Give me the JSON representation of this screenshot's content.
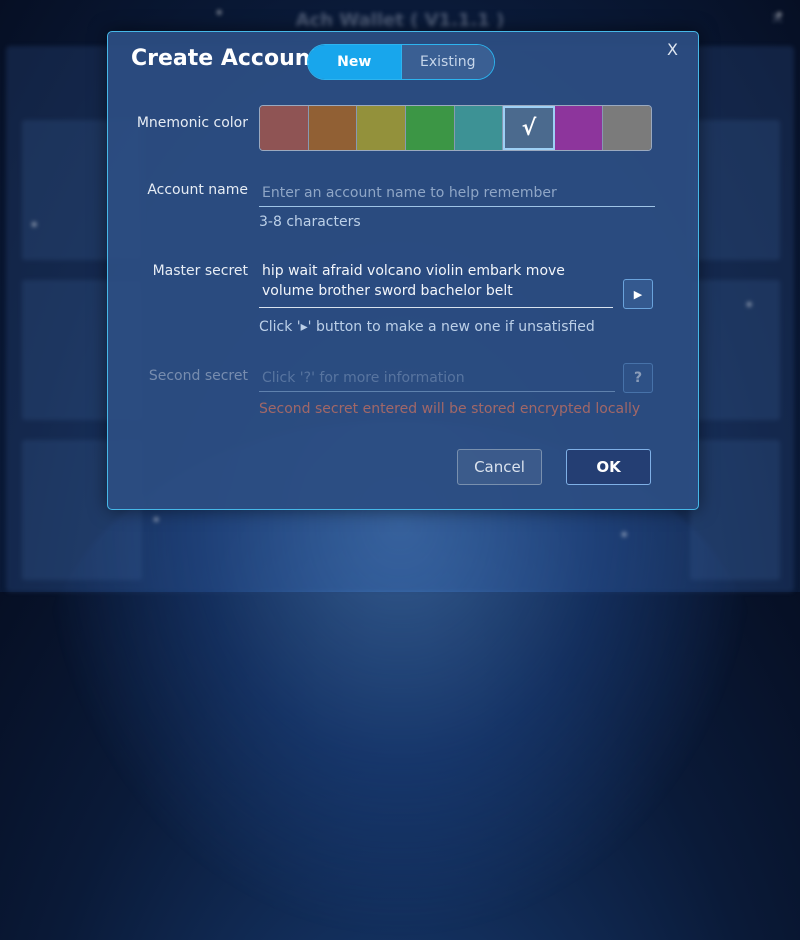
{
  "background": {
    "app_title": "Ach Wallet ( V1.1.1 )",
    "close_label": "×"
  },
  "modal": {
    "title": "Create Account",
    "close_label": "X",
    "tabs": [
      {
        "label": "New",
        "active": true
      },
      {
        "label": "Existing",
        "active": false
      }
    ],
    "mnemonic_color": {
      "label": "Mnemonic color",
      "swatches": [
        "#8f5454",
        "#916034",
        "#93913b",
        "#3c9645",
        "#3d9295",
        "#4b6a8e",
        "#8d359c",
        "#7b7b7b"
      ],
      "selected_index": 5,
      "selected_mark": "√"
    },
    "account_name": {
      "label": "Account name",
      "placeholder": "Enter an account name to help remember",
      "value": "",
      "hint": "3-8 characters"
    },
    "master_secret": {
      "label": "Master secret",
      "value": "hip wait afraid volcano violin embark move volume brother sword bachelor belt",
      "regenerate_icon": "play-icon",
      "regenerate_glyph": "▶",
      "hint": "Click '▸' button to make a new one if unsatisfied"
    },
    "second_secret": {
      "label": "Second secret",
      "placeholder": "Click '?' for more information",
      "help_glyph": "?",
      "warning": "Second secret entered will be stored encrypted locally",
      "enabled": false
    },
    "buttons": {
      "cancel": "Cancel",
      "ok": "OK"
    }
  },
  "colors": {
    "accent": "#18a6ec",
    "border": "#46b8e8",
    "warning": "#f07a58"
  }
}
